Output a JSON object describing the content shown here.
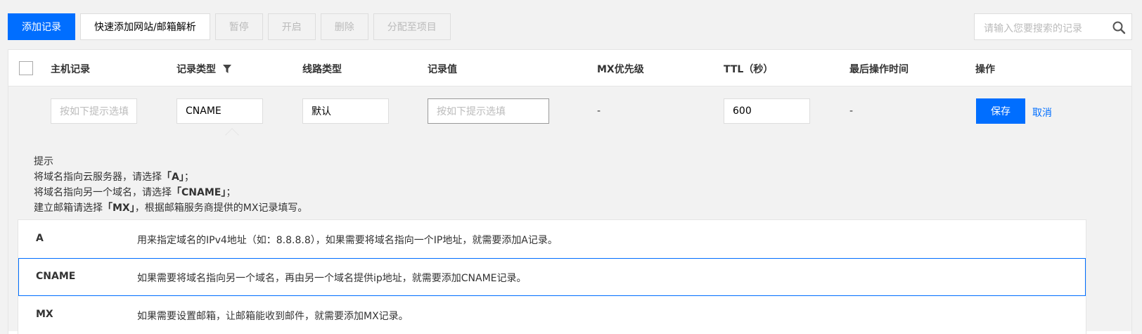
{
  "toolbar": {
    "add_record": "添加记录",
    "quick_add": "快速添加网站/邮箱解析",
    "pause": "暂停",
    "enable": "开启",
    "delete": "删除",
    "assign_project": "分配至项目"
  },
  "search": {
    "placeholder": "请输入您要搜索的记录",
    "icon": "search-icon"
  },
  "table": {
    "headers": {
      "host": "主机记录",
      "type": "记录类型",
      "line": "线路类型",
      "value": "记录值",
      "mx": "MX优先级",
      "ttl": "TTL（秒）",
      "last_op": "最后操作时间",
      "action": "操作"
    },
    "edit_row": {
      "host_placeholder": "按如下提示选填",
      "type_value": "CNAME",
      "line_value": "默认",
      "value_placeholder": "按如下提示选填",
      "mx_value": "-",
      "ttl_value": "600",
      "last_op_value": "-",
      "save": "保存",
      "cancel": "取消"
    }
  },
  "tips": {
    "title": "提示",
    "line1_prefix": "将域名指向云服务器，请选择",
    "line1_bold": "「A」",
    "line1_suffix": "；",
    "line2_prefix": "将域名指向另一个域名，请选择",
    "line2_bold": "「CNAME」",
    "line2_suffix": "；",
    "line3_prefix": "建立邮箱请选择",
    "line3_bold": "「MX」",
    "line3_suffix": "，根据邮箱服务商提供的MX记录填写。"
  },
  "record_types": [
    {
      "name": "A",
      "desc": "用来指定域名的IPv4地址（如：8.8.8.8），如果需要将域名指向一个IP地址，就需要添加A记录。"
    },
    {
      "name": "CNAME",
      "desc": "如果需要将域名指向另一个域名，再由另一个域名提供ip地址，就需要添加CNAME记录。"
    },
    {
      "name": "MX",
      "desc": "如果需要设置邮箱，让邮箱能收到邮件，就需要添加MX记录。"
    }
  ],
  "colors": {
    "primary": "#006eff",
    "background": "#f2f2f2"
  }
}
